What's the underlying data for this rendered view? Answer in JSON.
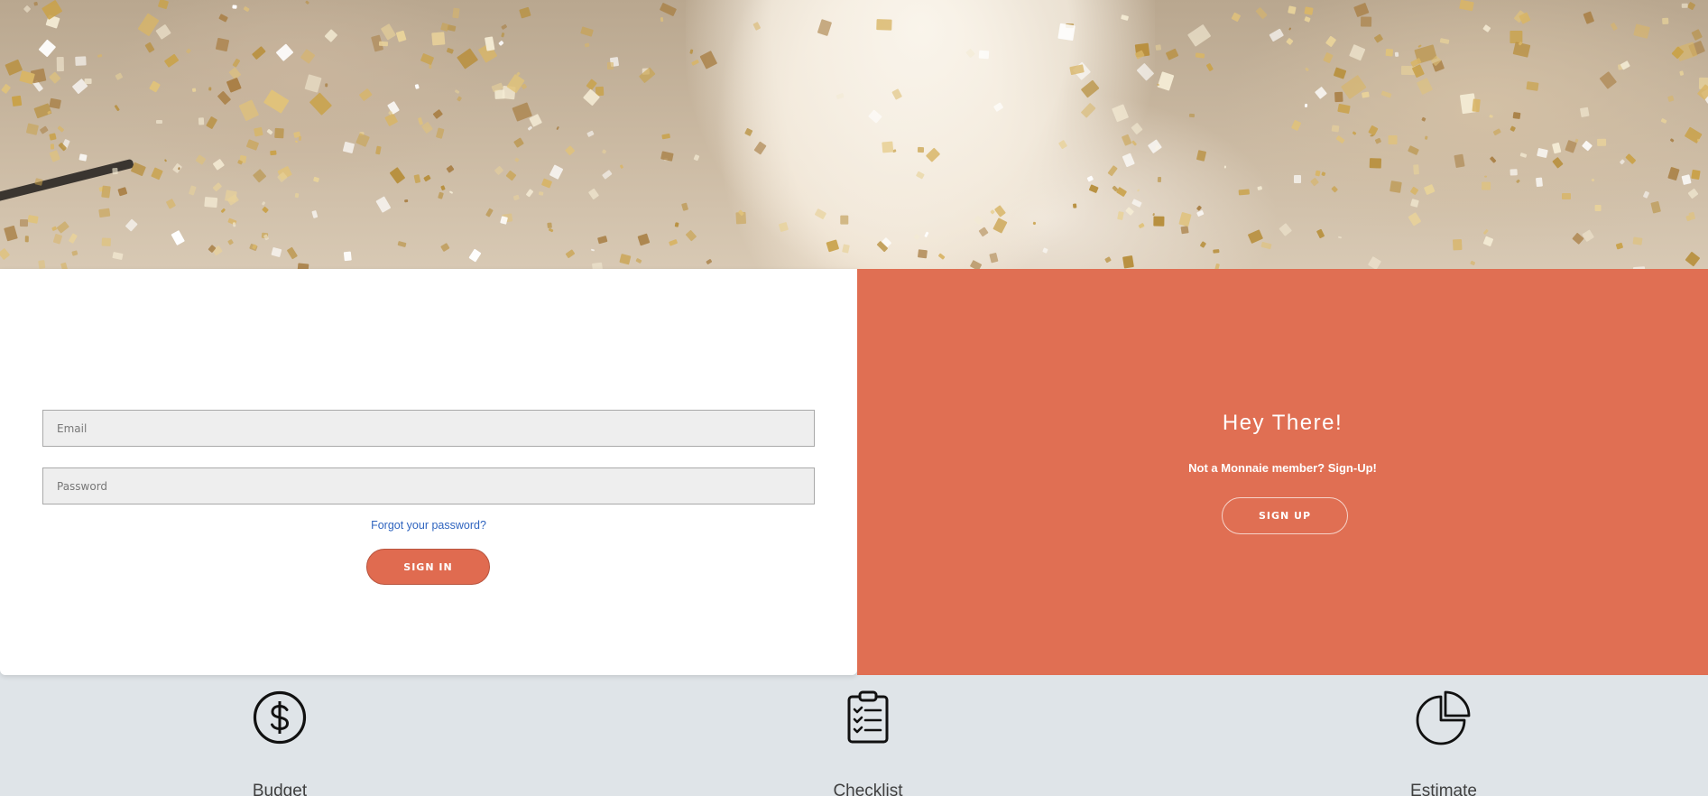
{
  "login": {
    "email_placeholder": "Email",
    "password_placeholder": "Password",
    "forgot_label": "Forgot your password?",
    "signin_label": "SIGN IN"
  },
  "signup": {
    "title": "Hey There!",
    "subtitle": "Not a Monnaie member? Sign-Up!",
    "button_label": "SIGN UP"
  },
  "features": {
    "budget": {
      "label": "Budget",
      "icon": "dollar-circle-icon"
    },
    "checklist": {
      "label": "Checklist",
      "icon": "clipboard-checklist-icon"
    },
    "estimate": {
      "label": "Estimate",
      "icon": "pie-chart-icon"
    }
  },
  "colors": {
    "accent": "#e06f53",
    "link": "#2f64bf",
    "feature_bg": "#dfe4e8"
  }
}
